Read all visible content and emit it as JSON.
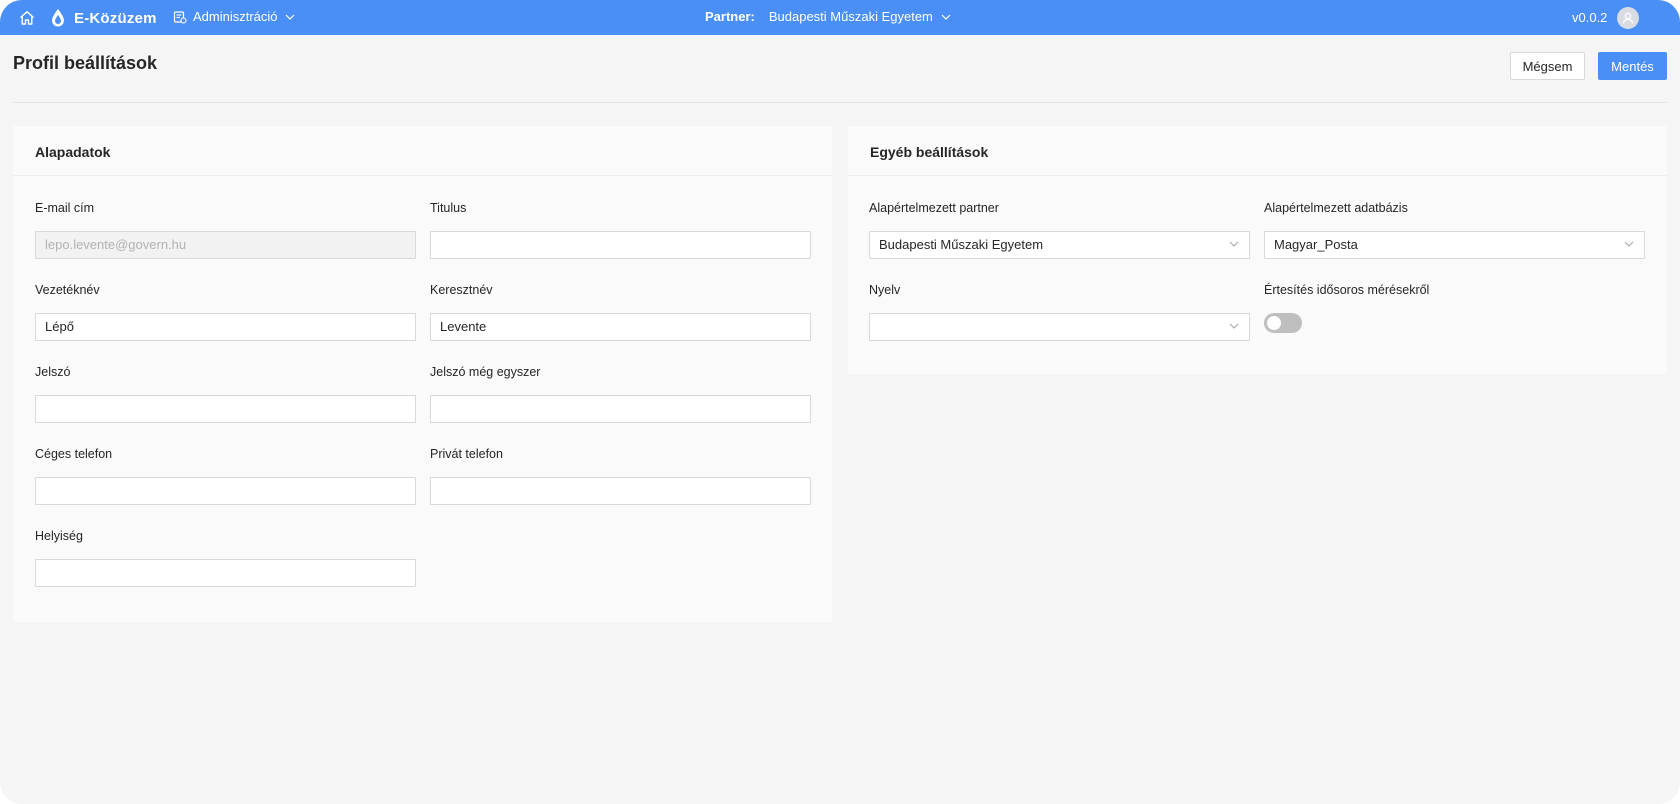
{
  "topbar": {
    "app_name": "E-Közüzem",
    "admin_label": "Adminisztráció",
    "partner_label": "Partner:",
    "partner_value": "Budapesti Műszaki Egyetem",
    "version": "v0.0.2"
  },
  "page": {
    "title": "Profil beállítások",
    "cancel_label": "Mégsem",
    "save_label": "Mentés"
  },
  "basic": {
    "title": "Alapadatok",
    "email": {
      "label": "E-mail cím",
      "value": "lepo.levente@govern.hu"
    },
    "titulus": {
      "label": "Titulus",
      "value": ""
    },
    "lastname": {
      "label": "Vezetéknév",
      "value": "Lépő"
    },
    "firstname": {
      "label": "Keresztnév",
      "value": "Levente"
    },
    "password": {
      "label": "Jelszó",
      "value": ""
    },
    "password2": {
      "label": "Jelszó még egyszer",
      "value": ""
    },
    "work_phone": {
      "label": "Céges telefon",
      "value": ""
    },
    "private_phone": {
      "label": "Privát telefon",
      "value": ""
    },
    "city": {
      "label": "Helyiség",
      "value": ""
    }
  },
  "other": {
    "title": "Egyéb beállítások",
    "default_partner": {
      "label": "Alapértelmezett partner",
      "value": "Budapesti Műszaki Egyetem"
    },
    "default_db": {
      "label": "Alapértelmezett adatbázis",
      "value": "Magyar_Posta"
    },
    "language": {
      "label": "Nyelv",
      "value": ""
    },
    "notify": {
      "label": "Értesítés idősoros mérésekről",
      "enabled": false
    }
  },
  "colors": {
    "accent": "#4a8ff5",
    "background": "#f5f5f5",
    "card": "#fafafa"
  }
}
